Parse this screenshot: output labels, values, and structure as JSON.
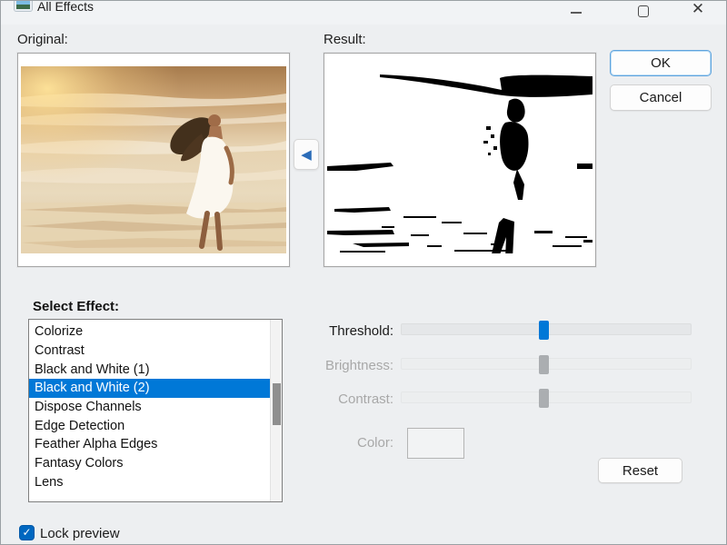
{
  "window": {
    "title": "All Effects"
  },
  "icons": {
    "app_icon": "image-thumbnail-icon",
    "close_glyph": "✕",
    "arrow_glyph": "◀",
    "check_glyph": "✓"
  },
  "previews": {
    "original_label": "Original:",
    "result_label": "Result:",
    "original_description": "Woman in a white dress with long flowing hair walking on a sunlit beach with waves",
    "result_description": "Black and white threshold rendering: dark silhouette of the woman and wave streaks on white"
  },
  "buttons": {
    "ok": "OK",
    "cancel": "Cancel",
    "reset": "Reset"
  },
  "effects": {
    "label": "Select Effect:",
    "items": [
      "Colorize",
      "Contrast",
      "Black and White (1)",
      "Black and White (2)",
      "Dispose Channels",
      "Edge Detection",
      "Feather Alpha Edges",
      "Fantasy Colors",
      "Lens"
    ],
    "selected": "Black and White (2)",
    "selected_index": 3
  },
  "controls": {
    "sliders": [
      {
        "label": "Threshold:",
        "enabled": true,
        "value_pct": 49
      },
      {
        "label": "Brightness:",
        "enabled": false,
        "value_pct": 49
      },
      {
        "label": "Contrast:",
        "enabled": false,
        "value_pct": 49
      }
    ],
    "color": {
      "label": "Color:",
      "enabled": false,
      "value": ""
    }
  },
  "footer": {
    "lock_preview_label": "Lock preview",
    "lock_preview_checked": true
  },
  "colors": {
    "accent": "#0078d7",
    "checkbox_blue": "#0067c0",
    "selection_blue": "#0078d7",
    "dialog_bg": "#edeff1"
  }
}
